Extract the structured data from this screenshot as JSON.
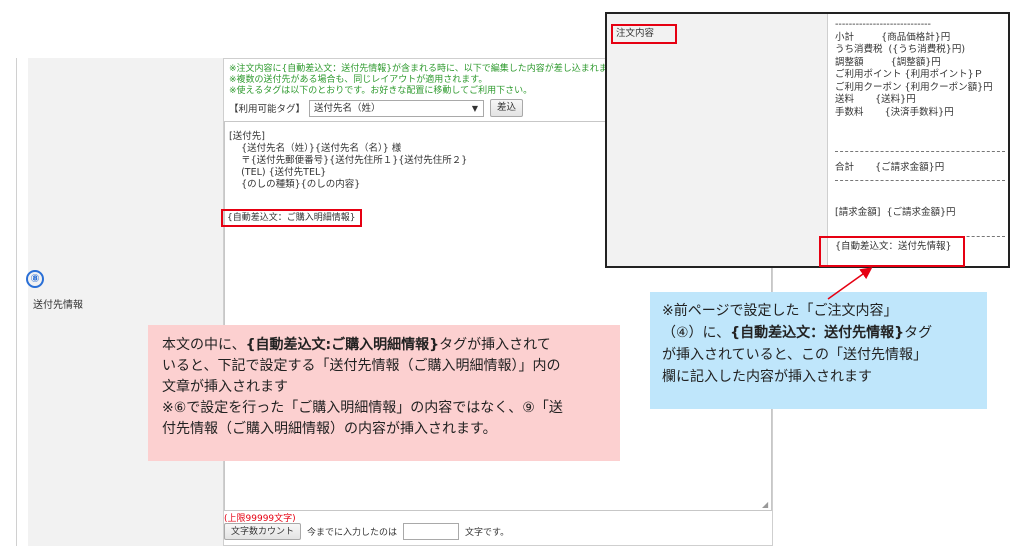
{
  "form": {
    "step_number": "⑧",
    "field_label": "送付先情報",
    "notes": [
      "※注文内容に{自動差込文：送付先情報}が含まれる時に、以下で編集した内容が差し込まれます",
      "※複数の送付先がある場合も、同じレイアウトが適用されます。",
      "※使えるタグは以下のとおりです。お好きな配置に移動してご利用下さい。"
    ],
    "tag_label": "【利用可能タグ】",
    "tag_selected": "送付先名（姓）",
    "insert_button": "差込",
    "body_text": "[送付先]\n    {送付先名（姓）}{送付先名（名）} 様\n    〒{送付先郵便番号}{送付先住所１}{送付先住所２}\n    (TEL) {送付先TEL}\n    {のしの種類}{のしの内容}",
    "auto_tag_purchase": "{自動差込文：ご購入明細情報}",
    "limit_text": "(上限99999文字)",
    "count_button": "文字数カウント",
    "count_prefix": "今までに入力したのは",
    "count_suffix": "文字です。"
  },
  "order_panel": {
    "label": "注文内容",
    "lines_top": "----------------------------\n小計         {商品価格計}円\nうち消費税  ({うち消費税}円)\n調整額         {調整額}円\nご利用ポイント {利用ポイント}Ｐ\nご利用クーポン {利用クーポン額}円\n送料       {送料}円\n手数料       {決済手数料}円",
    "lines_total": "合計       {ご請求金額}円",
    "lines_billing": "[請求金額]  {ご請求金額}円",
    "auto_tag_shipping": "{自動差込文：送付先情報}"
  },
  "callouts": {
    "pink_line1a": "本文の中に、",
    "pink_line1b": "{自動差込文:ご購入明細情報}",
    "pink_line1c": "タグが挿入されて",
    "pink_line2": "いると、下記で設定する「送付先情報（ご購入明細情報）」内の",
    "pink_line3": "文章が挿入されます",
    "pink_line4": "※⑥で設定を行った「ご購入明細情報」の内容ではなく、⑨「送",
    "pink_line5": "付先情報（ご購入明細情報）の内容が挿入されます。",
    "blue_line1": "※前ページで設定した「ご注文内容」",
    "blue_line2a": "（④）に、",
    "blue_line2b": "{自動差込文：送付先情報}",
    "blue_line2c": "タグ",
    "blue_line3": "が挿入されていると、この「送付先情報」",
    "blue_line4": "欄に記入した内容が挿入されます"
  },
  "colors": {
    "highlight_red": "#e60012",
    "note_green": "#2e9a2e",
    "circle_blue": "#2a6fd6",
    "pink_callout": "#fcd0d0",
    "blue_callout": "#bfe6fb"
  }
}
